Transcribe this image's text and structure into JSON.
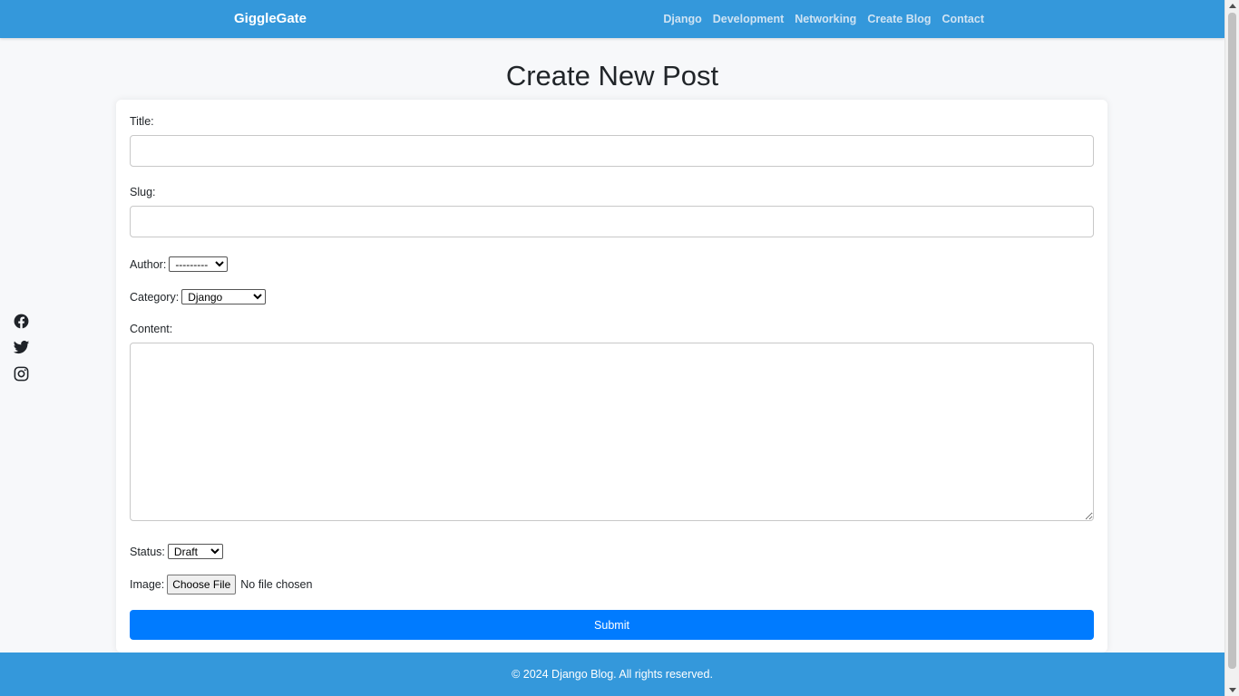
{
  "nav": {
    "brand": "GiggleGate",
    "links": [
      "Django",
      "Development",
      "Networking",
      "Create Blog",
      "Contact"
    ]
  },
  "page": {
    "title": "Create New Post"
  },
  "form": {
    "title_label": "Title:",
    "title_value": "",
    "slug_label": "Slug:",
    "slug_value": "",
    "author_label": "Author:",
    "author_selected": "---------",
    "category_label": "Category:",
    "category_selected": "Django",
    "content_label": "Content:",
    "content_value": "",
    "status_label": "Status:",
    "status_selected": "Draft",
    "image_label": "Image:",
    "file_button": "Choose File",
    "file_status": "No file chosen",
    "submit_label": "Submit"
  },
  "social": {
    "icons": [
      "facebook-icon",
      "twitter-icon",
      "instagram-icon"
    ]
  },
  "footer": {
    "text": "© 2024 Django Blog. All rights reserved."
  },
  "colors": {
    "nav_bg": "#3498db",
    "submit_bg": "#007bff",
    "page_bg": "#f7f8fa"
  }
}
